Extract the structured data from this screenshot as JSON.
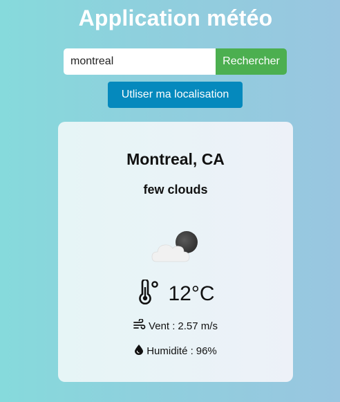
{
  "app": {
    "title": "Application météo"
  },
  "search": {
    "value": "montreal",
    "button_label": "Rechercher"
  },
  "location_button_label": "Utliser ma localisation",
  "weather": {
    "city": "Montreal, CA",
    "description": "few clouds",
    "icon": "few-clouds-night-icon",
    "temperature": "12°C",
    "wind_label": "Vent :",
    "wind_value": "2.57 m/s",
    "humidity_label": "Humidité :",
    "humidity_value": "96%"
  },
  "colors": {
    "search_button": "#4caf50",
    "location_button": "#0589bd",
    "title": "#ffffff"
  }
}
